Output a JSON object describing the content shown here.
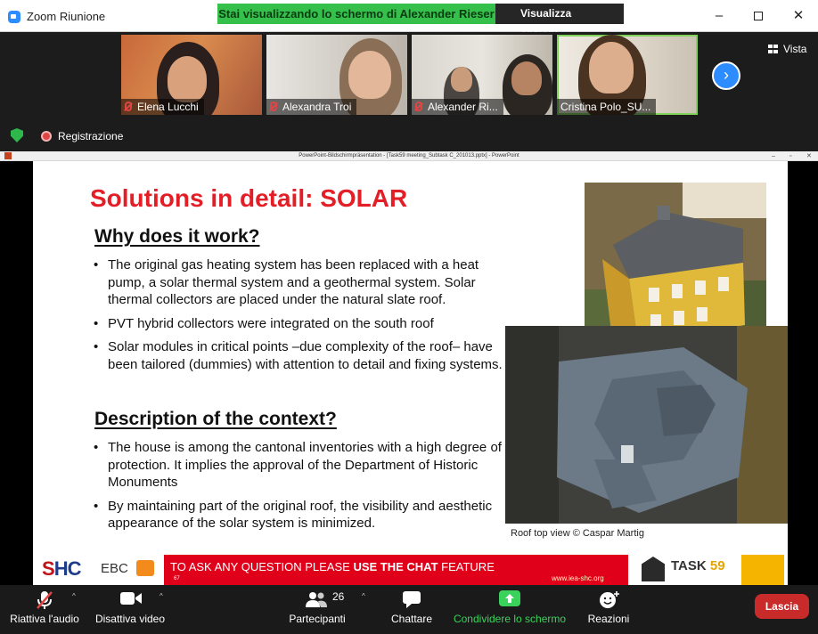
{
  "window": {
    "title": "Zoom Riunione"
  },
  "share_banner": {
    "text": "Stai visualizzando lo schermo di Alexander Rieser"
  },
  "view_options": {
    "label": "Visualizza opzioni"
  },
  "participants_strip": [
    {
      "name": "Elena Lucchi",
      "muted": true
    },
    {
      "name": "Alexandra Troi",
      "muted": true
    },
    {
      "name": "Alexander Ri...",
      "muted": true
    },
    {
      "name": "Cristina Polo_SU...",
      "muted": false,
      "active_speaker": true
    }
  ],
  "vista": {
    "label": "Vista"
  },
  "recording": {
    "label": "Registrazione"
  },
  "powerpoint": {
    "title": "PowerPoint-Bildschirmpräsentation - [Task59 meeting_Subtask C_201013.pptx] - PowerPoint"
  },
  "slide": {
    "title": "Solutions in detail: SOLAR",
    "section1": {
      "heading": "Why does it work?",
      "bullets": [
        "The original gas heating system has been replaced with a heat pump, a solar thermal system and a geothermal system. Solar thermal collectors are placed under the natural slate roof.",
        "PVT hybrid collectors were integrated on the south roof",
        "Solar modules in critical points –due complexity of the roof– have been tailored (dummies) with attention to detail and fixing systems."
      ]
    },
    "section2": {
      "heading": "Description of the context?",
      "bullets": [
        "The house is among the cantonal inventories with a high degree of protection. It implies the approval of the Department of Historic Monuments",
        "By maintaining part of the original roof, the visibility and aesthetic appearance of the solar system is minimized."
      ]
    },
    "caption": "Roof top view © Caspar Martig",
    "footer": {
      "shc_logo_a": "S",
      "shc_logo_b": "HC",
      "ebc_logo": "EBC",
      "chat_prefix": "TO ASK ANY QUESTION PLEASE ",
      "chat_bold": "USE THE CHAT",
      "chat_suffix": " FEATURE",
      "slide_number": "67",
      "iea_link": "www.iea-shc.org",
      "task_label": "TASK",
      "task_number": "59"
    }
  },
  "toolbar": {
    "audio": "Riattiva l'audio",
    "video": "Disattiva video",
    "participants": "Partecipanti",
    "participants_count": "26",
    "chat": "Chattare",
    "share": "Condividere lo schermo",
    "reactions": "Reazioni",
    "leave": "Lascia"
  },
  "colors": {
    "share_banner": "#34c04a",
    "slide_title": "#e41e26",
    "chat_banner": "#e1001a",
    "leave_button": "#c92b2b",
    "zoom_blue": "#2d8cff"
  }
}
